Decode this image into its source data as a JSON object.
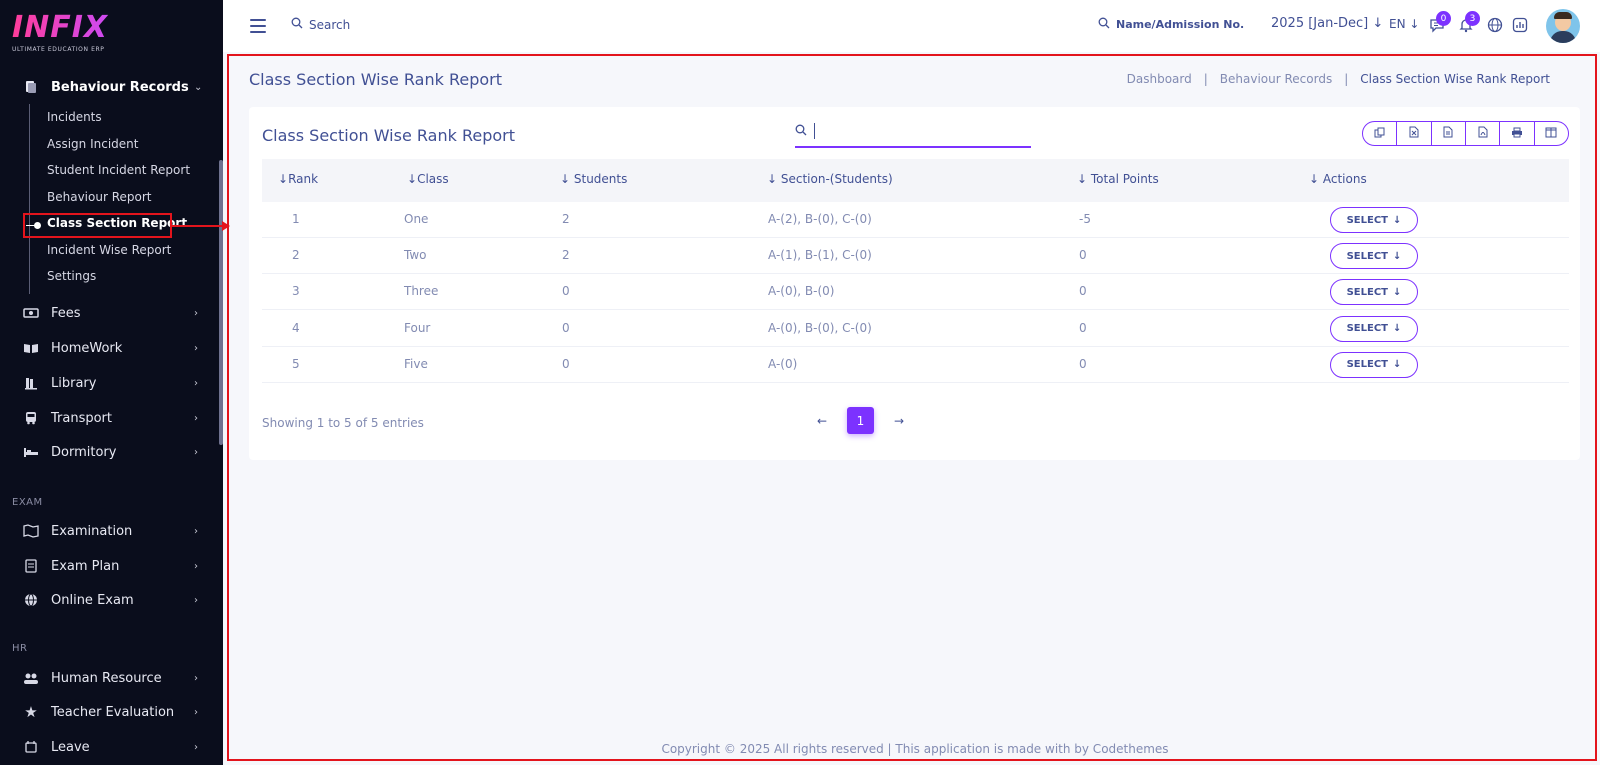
{
  "logo": {
    "word": "INFIX",
    "sub": "ULTIMATE EDUCATION ERP"
  },
  "sidebar": {
    "open_group": {
      "label": "Behaviour Records",
      "chevron": "⌄"
    },
    "sub_items": [
      {
        "label": "Incidents"
      },
      {
        "label": "Assign Incident"
      },
      {
        "label": "Student Incident Report"
      },
      {
        "label": "Behaviour Report"
      },
      {
        "label": "Class Section Report"
      },
      {
        "label": "Incident Wise Report"
      },
      {
        "label": "Settings"
      }
    ],
    "groups": [
      {
        "label": "Fees",
        "icon": "fees-icon"
      },
      {
        "label": "HomeWork",
        "icon": "book-icon"
      },
      {
        "label": "Library",
        "icon": "library-icon"
      },
      {
        "label": "Transport",
        "icon": "bus-icon"
      },
      {
        "label": "Dormitory",
        "icon": "bed-icon"
      }
    ],
    "exam_title": "EXAM",
    "exam_groups": [
      {
        "label": "Examination",
        "icon": "map-icon"
      },
      {
        "label": "Exam Plan",
        "icon": "exam-plan-icon"
      },
      {
        "label": "Online Exam",
        "icon": "globe-icon"
      }
    ],
    "hr_title": "HR",
    "hr_groups": [
      {
        "label": "Human Resource",
        "icon": "people-icon"
      },
      {
        "label": "Teacher Evaluation",
        "icon": "star-icon"
      },
      {
        "label": "Leave",
        "icon": "leave-icon"
      }
    ]
  },
  "topbar": {
    "search_label": "Search",
    "admission_search": "Name/Admission No.",
    "session": "2025 [Jan-Dec]",
    "language": "EN",
    "message_count": "0",
    "notification_count": "3"
  },
  "page": {
    "title": "Class Section Wise Rank Report",
    "breadcrumb": [
      "Dashboard",
      "|",
      "Behaviour Records",
      "|",
      "Class Section Wise Rank Report"
    ]
  },
  "card": {
    "title": "Class Section Wise Rank Report",
    "search_value": ""
  },
  "table": {
    "headers": [
      "Rank",
      "Class",
      "Students",
      "Section-(Students)",
      "Total Points",
      "Actions"
    ],
    "rows": [
      {
        "rank": "1",
        "class": "One",
        "students": "2",
        "sections": "A-(2), B-(0), C-(0)",
        "points": "-5",
        "action": "SELECT"
      },
      {
        "rank": "2",
        "class": "Two",
        "students": "2",
        "sections": "A-(1), B-(1), C-(0)",
        "points": "0",
        "action": "SELECT"
      },
      {
        "rank": "3",
        "class": "Three",
        "students": "0",
        "sections": "A-(0), B-(0)",
        "points": "0",
        "action": "SELECT"
      },
      {
        "rank": "4",
        "class": "Four",
        "students": "0",
        "sections": "A-(0), B-(0), C-(0)",
        "points": "0",
        "action": "SELECT"
      },
      {
        "rank": "5",
        "class": "Five",
        "students": "0",
        "sections": "A-(0)",
        "points": "0",
        "action": "SELECT"
      }
    ]
  },
  "pagination": {
    "showing": "Showing 1 to 5 of 5 entries",
    "current_page": "1"
  },
  "footer": {
    "text": "Copyright © 2025 All rights reserved | This application is made with by Codethemes"
  },
  "colors": {
    "accent": "#7c32ff",
    "sidebar_bg": "#0a0d1c",
    "text": "#415094",
    "muted": "#828bb2",
    "highlight": "#e3141c"
  }
}
